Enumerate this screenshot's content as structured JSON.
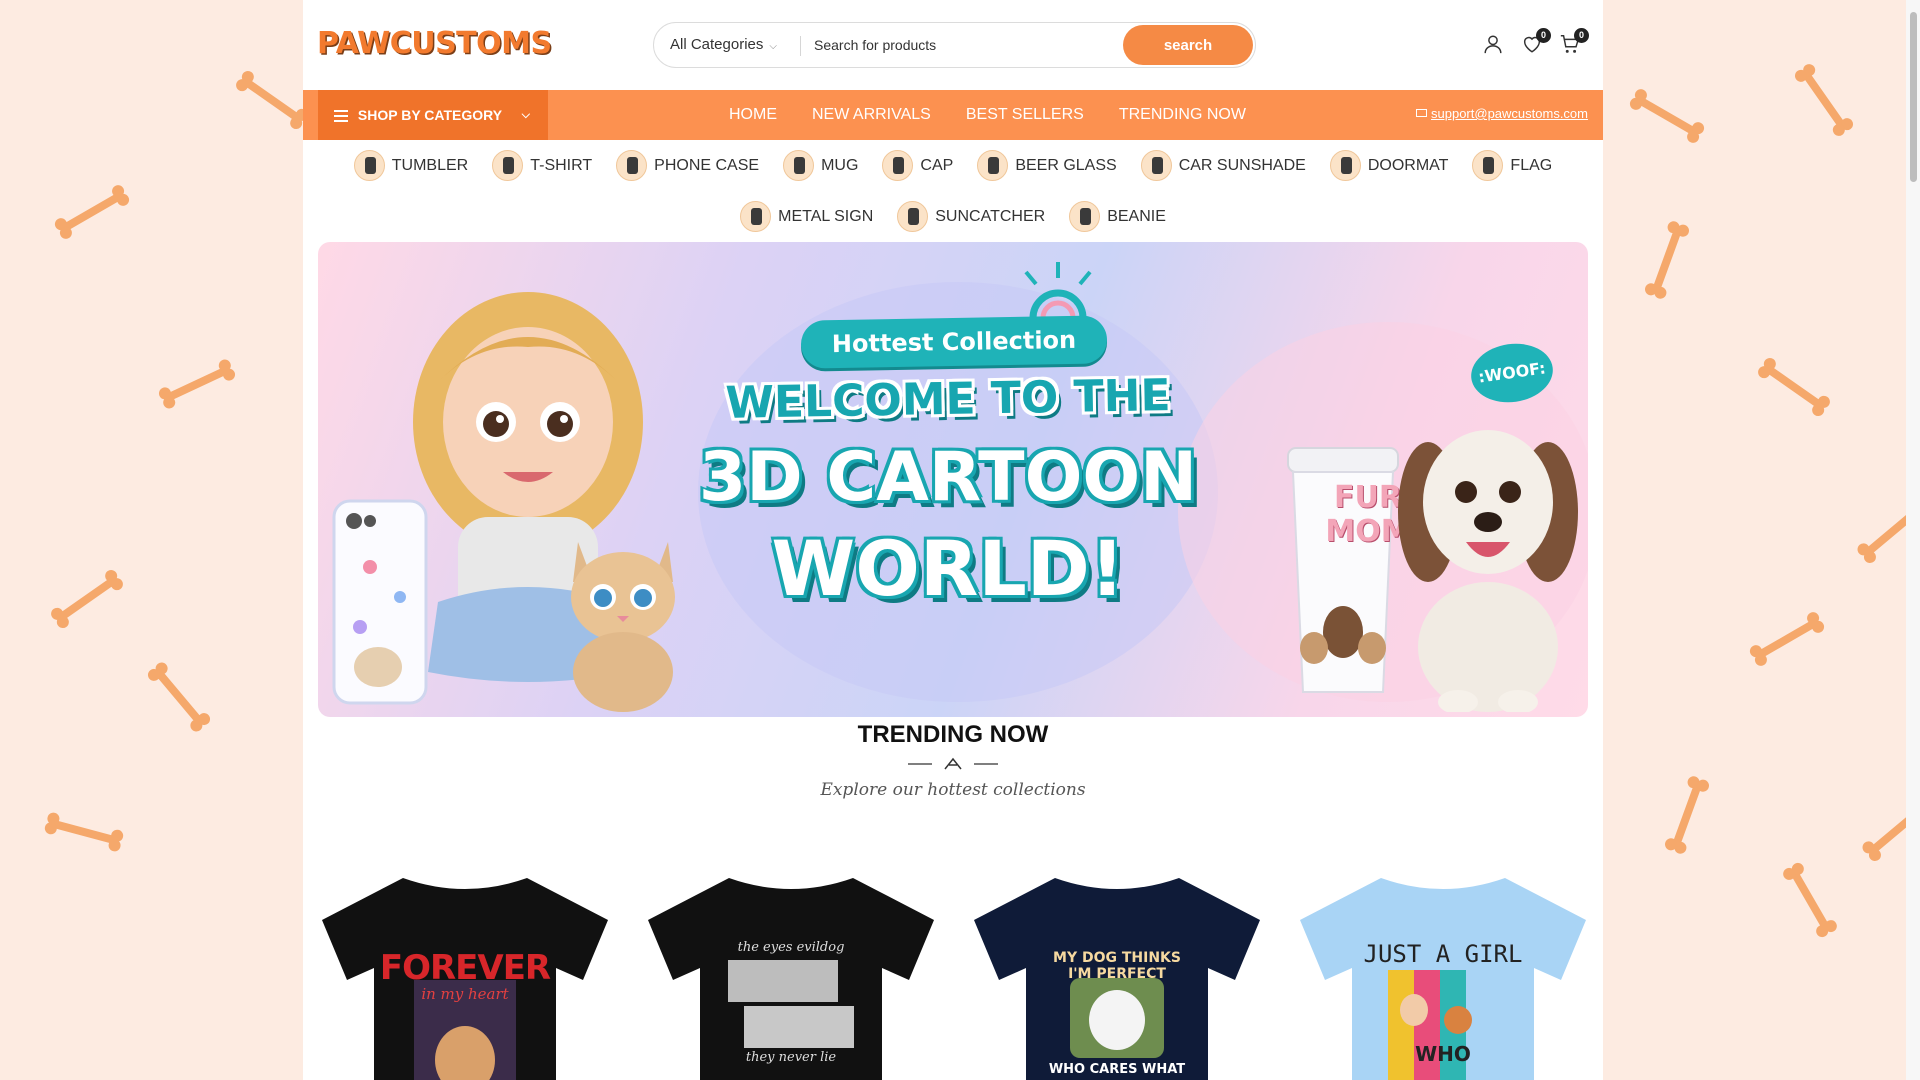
{
  "brand": {
    "logo_text": "PAWCUSTOMS",
    "accent": "#fc9150",
    "accent_dark": "#f0732a"
  },
  "header": {
    "category_select": "All Categories",
    "search_placeholder": "Search for products",
    "search_button": "search",
    "wishlist_count": "0",
    "cart_count": "0",
    "icons": [
      "user-icon",
      "heart-icon",
      "cart-icon"
    ]
  },
  "nav": {
    "shop_by_category": "SHOP BY CATEGORY",
    "items": [
      "HOME",
      "NEW ARRIVALS",
      "BEST SELLERS",
      "TRENDING NOW"
    ],
    "support_email": "support@pawcustoms.com"
  },
  "categories": [
    "TUMBLER",
    "T-SHIRT",
    "PHONE CASE",
    "MUG",
    "CAP",
    "BEER GLASS",
    "CAR SUNSHADE",
    "DOORMAT",
    "FLAG",
    "METAL SIGN",
    "SUNCATCHER",
    "BEANIE"
  ],
  "banner": {
    "tag": "Hottest Collection",
    "line1": "WELCOME TO THE",
    "line2": "3D CARTOON",
    "line3": "WORLD!",
    "bubble": ":WOOF:",
    "cup_line1": "FUR",
    "cup_line2": "MOM"
  },
  "trending": {
    "title": "TRENDING NOW",
    "subtitle": "Explore our hottest collections",
    "products": [
      {
        "shirt_color": "#111111",
        "print_top": "FOREVER",
        "print_sub": "in my heart"
      },
      {
        "shirt_color": "#111111",
        "print_top": "the eyes evildog",
        "print_sub": "they never lie"
      },
      {
        "shirt_color": "#0f1b38",
        "print_top": "MY DOG THINKS I'M PERFECT",
        "print_sub": "WHO CARES WHAT"
      },
      {
        "shirt_color": "#a9d4f5",
        "print_top": "JUST A GIRL",
        "print_sub": "WHO"
      }
    ]
  }
}
